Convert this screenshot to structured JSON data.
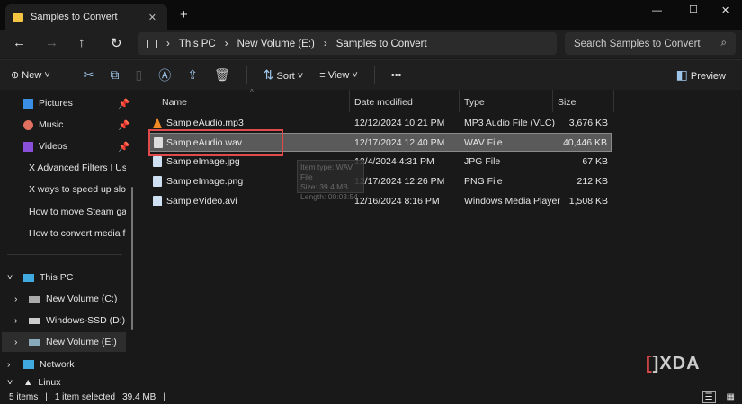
{
  "window": {
    "tab_title": "Samples to Convert",
    "new_tab": "+",
    "minimize": "—",
    "maximize": "☐",
    "close": "✕",
    "tab_close": "✕"
  },
  "nav": {
    "back": "←",
    "forward": "→",
    "up": "↑",
    "refresh": "↻"
  },
  "breadcrumb": [
    "This PC",
    "New Volume (E:)",
    "Samples to Convert"
  ],
  "search": {
    "placeholder": "Search Samples to Convert"
  },
  "toolbar": {
    "new": "New",
    "sort": "Sort",
    "view": "View",
    "more": "•••",
    "preview": "Preview"
  },
  "sidebar": {
    "items": [
      {
        "label": "Pictures",
        "icon": "pictures-icon",
        "pinned": true
      },
      {
        "label": "Music",
        "icon": "music-icon",
        "pinned": true
      },
      {
        "label": "Videos",
        "icon": "videos-icon",
        "pinned": true
      },
      {
        "label": "X Advanced Filters I Use",
        "icon": "folder-icon"
      },
      {
        "label": "X ways to speed up slow",
        "icon": "folder-icon"
      },
      {
        "label": "How to move Steam gan",
        "icon": "folder-icon"
      },
      {
        "label": "How to convert media fil",
        "icon": "folder-icon"
      },
      {
        "label": "This PC",
        "icon": "pc-icon"
      },
      {
        "label": "New Volume (C:)",
        "icon": "drive-icon"
      },
      {
        "label": "Windows-SSD (D:)",
        "icon": "drive-icon"
      },
      {
        "label": "New Volume (E:)",
        "icon": "drive-icon"
      },
      {
        "label": "Network",
        "icon": "network-icon"
      },
      {
        "label": "Linux",
        "icon": "linux-icon"
      }
    ]
  },
  "columns": {
    "name": "Name",
    "date": "Date modified",
    "type": "Type",
    "size": "Size"
  },
  "files": [
    {
      "name": "SampleAudio.mp3",
      "date": "12/12/2024 10:21 PM",
      "type": "MP3 Audio File (VLC)",
      "size": "3,676 KB"
    },
    {
      "name": "SampleAudio.wav",
      "date": "12/17/2024 12:40 PM",
      "type": "WAV File",
      "size": "40,446 KB"
    },
    {
      "name": "SampleImage.jpg",
      "date": "12/4/2024 4:31 PM",
      "type": "JPG File",
      "size": "67 KB"
    },
    {
      "name": "SampleImage.png",
      "date": "12/17/2024 12:26 PM",
      "type": "PNG File",
      "size": "212 KB"
    },
    {
      "name": "SampleVideo.avi",
      "date": "12/16/2024 8:16 PM",
      "type": "Windows Media Player",
      "size": "1,508 KB"
    }
  ],
  "tooltip": {
    "type": "Item type: WAV File",
    "size": "Size: 39.4 MB",
    "length": "Length: 00:03:54"
  },
  "status": {
    "count": "5 items",
    "selected": "1 item selected",
    "size": "39.4 MB"
  },
  "watermark": "XDA"
}
